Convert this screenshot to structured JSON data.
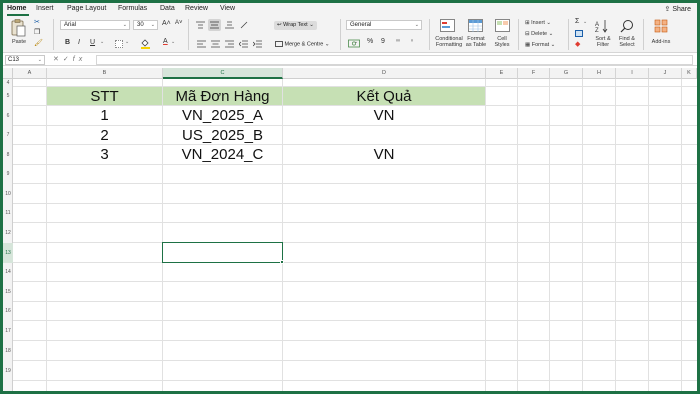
{
  "tabs": [
    "Home",
    "Insert",
    "Page Layout",
    "Formulas",
    "Data",
    "Review",
    "View"
  ],
  "share_label": "Share",
  "ribbon": {
    "paste_label": "Paste",
    "font_name": "Arial",
    "font_size": "30",
    "bold": "B",
    "italic": "I",
    "underline": "U",
    "grow_font": "A˄",
    "shrink_font": "A˅",
    "wrap_text": "Wrap Text",
    "merge_centre": "Merge & Centre",
    "number_format": "General",
    "percent": "%",
    "comma": "9",
    "conditional_formatting": [
      "Conditional",
      "Formatting"
    ],
    "format_as_table": [
      "Format",
      "as Table"
    ],
    "cell_styles": [
      "Cell",
      "Styles"
    ],
    "insert": "Insert",
    "delete": "Delete",
    "format": "Format",
    "sort_filter": [
      "Sort &",
      "Filter"
    ],
    "find_select": [
      "Find &",
      "Select"
    ],
    "add_ins": "Add-ins",
    "colors": {
      "accent": "#1e7145",
      "header_fill": "#c6e0b4",
      "font_red": "#e03c31",
      "highlight_yellow": "#f5d200"
    }
  },
  "formula_bar": {
    "name_box": "C13",
    "cancel": "✕",
    "enter": "✓",
    "fx": "fx",
    "value": ""
  },
  "columns": [
    "A",
    "B",
    "C",
    "D",
    "E",
    "F",
    "G",
    "H",
    "I",
    "J",
    "K"
  ],
  "rows": [
    "4",
    "5",
    "6",
    "7",
    "8",
    "9",
    "10",
    "11",
    "12",
    "13",
    "14",
    "15",
    "16",
    "17",
    "18",
    "19"
  ],
  "selected_cell": "C13",
  "table": {
    "headers": [
      "STT",
      "Mã Đơn Hàng",
      "Kết Quả"
    ],
    "rows": [
      [
        "1",
        "VN_2025_A",
        "VN"
      ],
      [
        "2",
        "US_2025_B",
        ""
      ],
      [
        "3",
        "VN_2024_C",
        "VN"
      ]
    ]
  }
}
